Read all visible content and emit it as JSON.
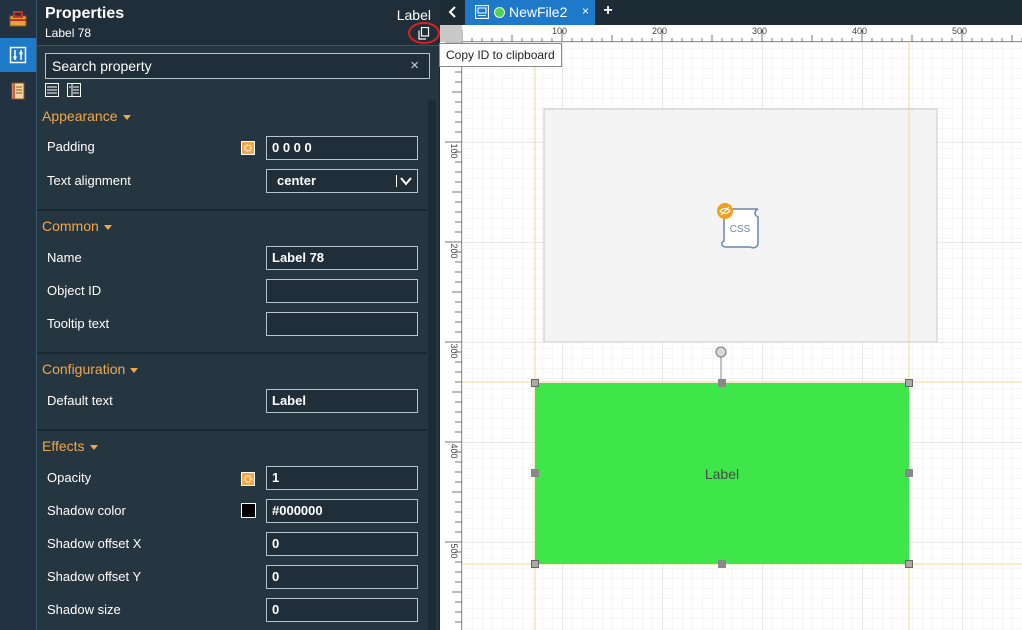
{
  "panel": {
    "title": "Properties",
    "subtitle": "Label 78",
    "type_label": "Label",
    "search_placeholder": "Search property",
    "clear_symbol": "×"
  },
  "tooltip": {
    "text": "Copy ID to clipboard"
  },
  "sections": {
    "appearance": {
      "header": "Appearance",
      "padding_label": "Padding",
      "padding_value": "0 0 0 0",
      "text_alignment_label": "Text alignment",
      "text_alignment_value": "center"
    },
    "common": {
      "header": "Common",
      "name_label": "Name",
      "name_value": "Label 78",
      "object_id_label": "Object ID",
      "object_id_value": "",
      "tooltip_label": "Tooltip text",
      "tooltip_value": ""
    },
    "configuration": {
      "header": "Configuration",
      "default_text_label": "Default text",
      "default_text_value": "Label"
    },
    "effects": {
      "header": "Effects",
      "opacity_label": "Opacity",
      "opacity_value": "1",
      "shadow_color_label": "Shadow color",
      "shadow_color_value": "#000000",
      "shadow_offset_x_label": "Shadow offset X",
      "shadow_offset_x_value": "0",
      "shadow_offset_y_label": "Shadow offset Y",
      "shadow_offset_y_value": "0",
      "shadow_size_label": "Shadow size",
      "shadow_size_value": "0"
    }
  },
  "editor": {
    "tab_name": "NewFile2",
    "tab_close": "×",
    "tab_add": "+",
    "ruler_h_labels": [
      "100",
      "200",
      "300",
      "400",
      "500"
    ],
    "ruler_v_labels": [
      "100",
      "200",
      "300",
      "400",
      "500"
    ],
    "css_badge_text": "CSS",
    "label_text": "Label"
  },
  "colors": {
    "accent": "#1e79c9",
    "section_header": "#f0a84a",
    "label_fill": "#3ee64a",
    "panel_bg": "#263641"
  },
  "icons": {
    "activity": [
      "toolbox-icon",
      "properties-icon",
      "book-icon"
    ],
    "header": "copy-icon",
    "views": [
      "list-view-icon",
      "detail-view-icon"
    ],
    "canvas": "css-scroll-icon"
  }
}
